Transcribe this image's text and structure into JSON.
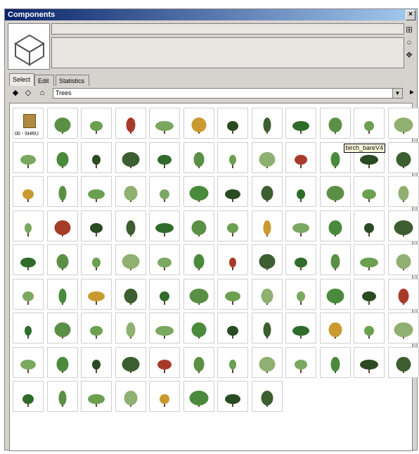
{
  "window": {
    "title": "Components",
    "close_label": "×"
  },
  "tabs": [
    {
      "label": "Select",
      "active": true
    },
    {
      "label": "Edit",
      "active": false
    },
    {
      "label": "Statistics",
      "active": false
    }
  ],
  "nav": {
    "back_icon": "back-arrow-icon",
    "forward_icon": "forward-arrow-icon",
    "home_icon": "home-icon",
    "collection": "Trees",
    "details_icon": "details-arrow-icon"
  },
  "first_item_label": "00 - SHRU",
  "tooltip": "birch_bareV4",
  "colors": {
    "title_bar": "#0a246a",
    "panel": "#d6d3ce",
    "foliage": "#3f7a3a"
  },
  "components_count": 104
}
